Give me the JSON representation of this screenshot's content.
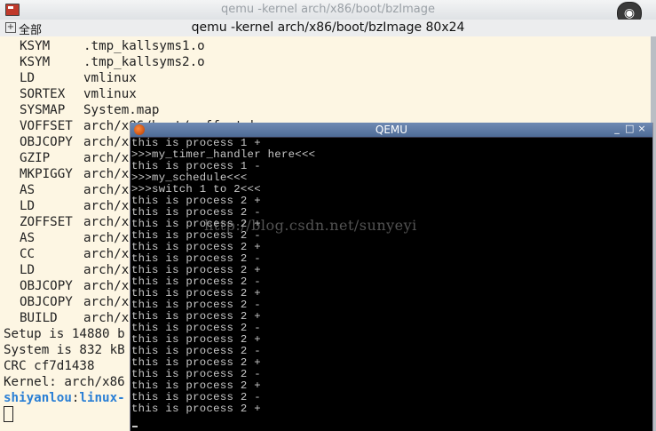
{
  "outer_window": {
    "title": "qemu -kernel arch/x86/boot/bzImage",
    "app_icon": "terminal-app-icon",
    "eye_icon": "eye-icon"
  },
  "terminal": {
    "menu_label": "全部",
    "title": "qemu -kernel arch/x86/boot/bzImage 80x24",
    "build_lines": [
      {
        "tag": "KSYM",
        "target": ".tmp_kallsyms1.o"
      },
      {
        "tag": "KSYM",
        "target": ".tmp_kallsyms2.o"
      },
      {
        "tag": "LD",
        "target": "vmlinux"
      },
      {
        "tag": "SORTEX",
        "target": "vmlinux"
      },
      {
        "tag": "SYSMAP",
        "target": "System.map"
      },
      {
        "tag": "VOFFSET",
        "target": "arch/x86/boot/voffset.h"
      },
      {
        "tag": "OBJCOPY",
        "target": "arch/x"
      },
      {
        "tag": "GZIP",
        "target": "arch/x"
      },
      {
        "tag": "MKPIGGY",
        "target": "arch/x"
      },
      {
        "tag": "AS",
        "target": "arch/x"
      },
      {
        "tag": "LD",
        "target": "arch/x"
      },
      {
        "tag": "ZOFFSET",
        "target": "arch/x"
      },
      {
        "tag": "AS",
        "target": "arch/x"
      },
      {
        "tag": "CC",
        "target": "arch/x"
      },
      {
        "tag": "LD",
        "target": "arch/x"
      },
      {
        "tag": "OBJCOPY",
        "target": "arch/x"
      },
      {
        "tag": "OBJCOPY",
        "target": "arch/x"
      },
      {
        "tag": "BUILD",
        "target": "arch/x"
      }
    ],
    "summary_lines": [
      "Setup is 14880 b",
      "System is 832 kB",
      "CRC cf7d1438",
      "Kernel: arch/x86"
    ],
    "prompt_user": "shiyanlou",
    "prompt_sep": ":",
    "prompt_host": "linux-"
  },
  "qemu": {
    "title": "QEMU",
    "min_label": "_",
    "max_label": "□",
    "close_label": "×",
    "output_lines": [
      "this is process 1 +",
      ">>>my_timer_handler here<<<",
      "this is process 1 -",
      ">>>my_schedule<<<",
      ">>>switch 1 to 2<<<",
      "this is process 2 +",
      "this is process 2 -",
      "this is process 2 +",
      "this is process 2 -",
      "this is process 2 +",
      "this is process 2 -",
      "this is process 2 +",
      "this is process 2 -",
      "this is process 2 +",
      "this is process 2 -",
      "this is process 2 +",
      "this is process 2 -",
      "this is process 2 +",
      "this is process 2 -",
      "this is process 2 +",
      "this is process 2 -",
      "this is process 2 +",
      "this is process 2 -",
      "this is process 2 +"
    ],
    "watermark": "http://blog.csdn.net/sunyeyi"
  }
}
